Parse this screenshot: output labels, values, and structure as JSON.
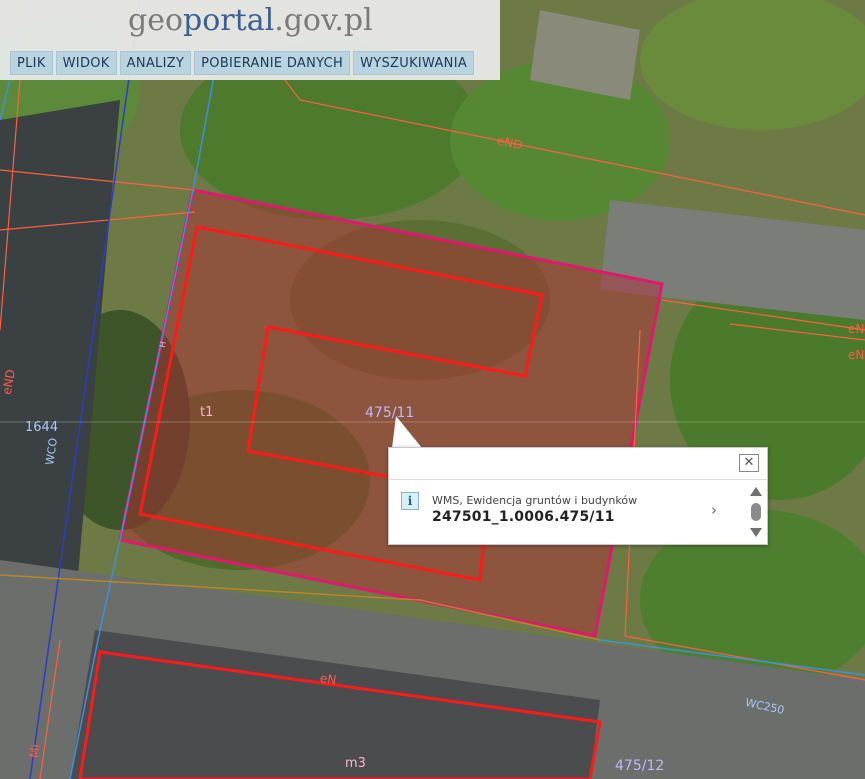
{
  "logo": {
    "geo": "geo",
    "portal": "portal",
    "domain": ".gov.pl"
  },
  "menu": [
    {
      "label": "PLIK"
    },
    {
      "label": "WIDOK"
    },
    {
      "label": "ANALIZY"
    },
    {
      "label": "POBIERANIE DANYCH"
    },
    {
      "label": "WYSZUKIWANIA"
    }
  ],
  "map_labels": {
    "parcel_main": "475/11",
    "building_t1": "t1",
    "parcel_475_12": "475/12",
    "m3": "m3",
    "en_top": "eND",
    "en_bottom": "eN",
    "wco_left": "WCO",
    "number_1644": "1644",
    "end_left": "eND",
    "e_right_1": "eN",
    "e_right_2": "eN",
    "wco250": "WC250",
    "m_left": "Mi",
    "h_vertical": "H"
  },
  "popup": {
    "layer": "WMS, Ewidencja gruntów i budynków",
    "feature_id": "247501_1.0006.475/11",
    "close_label": "✕",
    "info_label": "i",
    "next_label": "›"
  },
  "colors": {
    "parcel_outline": "#e0186e",
    "building_outline": "#ff1a1a",
    "parcel_fill": "rgba(180,40,50,0.45)",
    "parcel_lines": "#ff6040",
    "utility_blue": "#3f8fe0",
    "menu_bg": "#b9d3df"
  }
}
